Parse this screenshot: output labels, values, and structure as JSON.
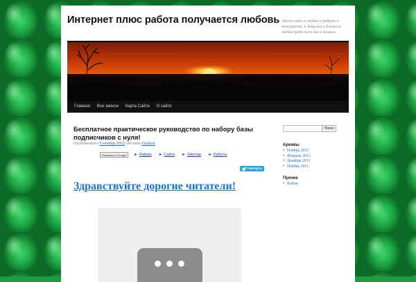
{
  "site": {
    "title": "Интернет плюс работа получается любовь",
    "description": "Этот сайт о любви к работе в интернете, к деньгам и близким людям ради чего мы и живем."
  },
  "nav": {
    "items": [
      "Главная",
      "Все записи",
      "Карта Сайта",
      "О сайте"
    ]
  },
  "post": {
    "title": "Бесплатное практическое руководство по набору базы подписчиков с нуля!",
    "meta_prefix": "Опубликовано",
    "date": "6 Ноябрь 2012",
    "meta_author_prefix": "автором",
    "author": "Vladimir",
    "greeting": "Здравствуйте дорогие читатели!"
  },
  "ads": {
    "badge_text": "Реклама от Google",
    "links": [
      "Rabota",
      "Сайта",
      "Sitemap",
      "Работы"
    ]
  },
  "tweet": {
    "label": "Твитнуть"
  },
  "sidebar": {
    "search_placeholder": "",
    "search_button": "Поиск",
    "archives_title": "Архивы",
    "archives": [
      "Ноябрь 2012",
      "Февраль 2012",
      "Декабрь 2011",
      "Ноябрь 2011"
    ],
    "other_title": "Прочее",
    "other": [
      "Войти"
    ]
  },
  "colors": {
    "background_green": "#1f9a3c",
    "nav_bar": "#111111",
    "link_blue": "#1b74c5",
    "tweet_blue": "#2f9fd8"
  }
}
